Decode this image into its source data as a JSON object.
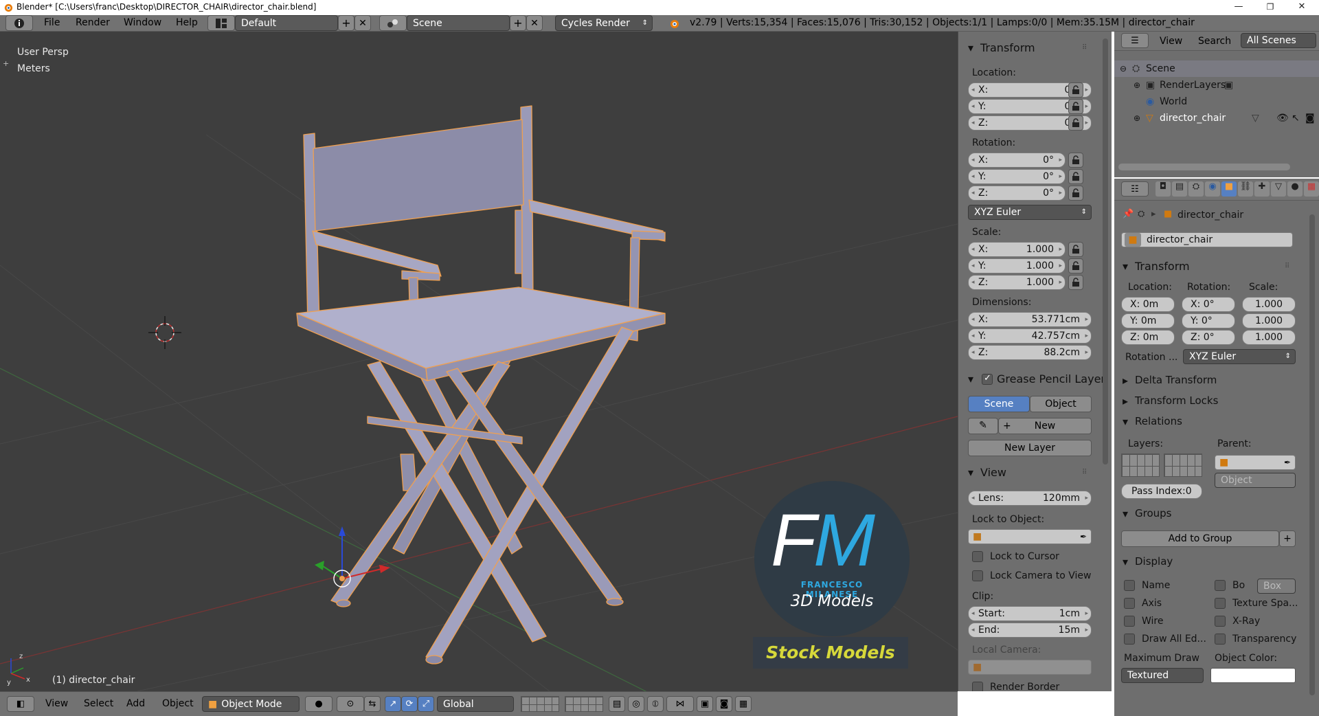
{
  "titlebar": {
    "text": "Blender* [C:\\Users\\franc\\Desktop\\DIRECTOR_CHAIR\\director_chair.blend]",
    "min": "—",
    "max": "❐",
    "close": "✕"
  },
  "topbar": {
    "menus": [
      "File",
      "Render",
      "Window",
      "Help"
    ],
    "screen_layout": "Default",
    "scene": "Scene",
    "engine": "Cycles Render",
    "stats": "v2.79 | Verts:15,354 | Faces:15,076 | Tris:30,152 | Objects:1/1 | Lamps:0/0 | Mem:35.15M | director_chair"
  },
  "viewport": {
    "view_name": "User Persp",
    "units": "Meters",
    "object_label": "(1) director_chair",
    "watermark": {
      "initials": "FM",
      "name": "FRANCESCO MILANESE",
      "sub": "3D Models",
      "banner": "Stock Models"
    }
  },
  "npanel": {
    "transform_title": "Transform",
    "location_label": "Location:",
    "location": [
      {
        "axis": "X:",
        "value": "0m"
      },
      {
        "axis": "Y:",
        "value": "0m"
      },
      {
        "axis": "Z:",
        "value": "0m"
      }
    ],
    "rotation_label": "Rotation:",
    "rotation": [
      {
        "axis": "X:",
        "value": "0°"
      },
      {
        "axis": "Y:",
        "value": "0°"
      },
      {
        "axis": "Z:",
        "value": "0°"
      }
    ],
    "rotation_mode": "XYZ Euler",
    "scale_label": "Scale:",
    "scale": [
      {
        "axis": "X:",
        "value": "1.000"
      },
      {
        "axis": "Y:",
        "value": "1.000"
      },
      {
        "axis": "Z:",
        "value": "1.000"
      }
    ],
    "dimensions_label": "Dimensions:",
    "dimensions": [
      {
        "axis": "X:",
        "value": "53.771cm"
      },
      {
        "axis": "Y:",
        "value": "42.757cm"
      },
      {
        "axis": "Z:",
        "value": "88.2cm"
      }
    ],
    "gp_title": "Grease Pencil Layer",
    "gp_scene": "Scene",
    "gp_object": "Object",
    "gp_new": "New",
    "gp_new_layer": "New Layer",
    "view_title": "View",
    "lens_label": "Lens:",
    "lens_value": "120mm",
    "lock_to_object": "Lock to Object:",
    "lock_to_cursor": "Lock to Cursor",
    "lock_camera": "Lock Camera to View",
    "clip_label": "Clip:",
    "clip_start_label": "Start:",
    "clip_start": "1cm",
    "clip_end_label": "End:",
    "clip_end": "15m",
    "local_camera": "Local Camera:",
    "render_border": "Render Border"
  },
  "outliner": {
    "menus": [
      "View",
      "Search"
    ],
    "filter": "All Scenes",
    "items": [
      "Scene",
      "RenderLayers",
      "World",
      "director_chair"
    ]
  },
  "props": {
    "breadcrumb": "director_chair",
    "object_name": "director_chair",
    "transform_title": "Transform",
    "location_label": "Location:",
    "rotation_label": "Rotation:",
    "scale_label": "Scale:",
    "loc": [
      "X: 0m",
      "Y: 0m",
      "Z: 0m"
    ],
    "rot": [
      "X: 0°",
      "Y: 0°",
      "Z: 0°"
    ],
    "scl": [
      "1.000",
      "1.000",
      "1.000"
    ],
    "rotation_mode_label": "Rotation ...",
    "rotation_mode": "XYZ Euler",
    "delta_transform": "Delta Transform",
    "transform_locks": "Transform Locks",
    "relations": "Relations",
    "layers_label": "Layers:",
    "parent_label": "Parent:",
    "parent_type": "Object",
    "pass_index": "Pass Index:0",
    "groups": "Groups",
    "add_to_group": "Add to Group",
    "display": "Display",
    "checks_left": [
      "Name",
      "Axis",
      "Wire",
      "Draw All Ed..."
    ],
    "checks_right": [
      "Bo",
      "Texture Spa...",
      "X-Ray",
      "Transparency"
    ],
    "bounds_type": "Box",
    "max_draw_label": "Maximum Draw",
    "max_draw": "Textured",
    "object_color_label": "Object Color:"
  },
  "bottombar": {
    "menus": [
      "View",
      "Select",
      "Add",
      "Object"
    ],
    "mode": "Object Mode",
    "orientation": "Global"
  },
  "colors": {
    "accent_blue": "#5680c2",
    "viewport_bg": "#3e3e3e",
    "panel_bg": "#6e6e6e",
    "chair": "#9d9dbd",
    "selection_outline": "#f0a050"
  }
}
